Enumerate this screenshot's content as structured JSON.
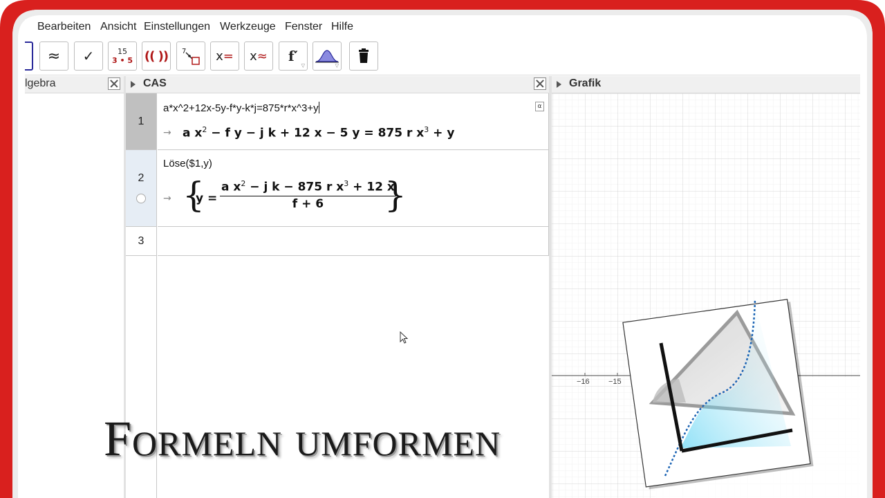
{
  "menu": [
    "Bearbeiten",
    "Ansicht",
    "Einstellungen",
    "Werkzeuge",
    "Fenster",
    "Hilfe"
  ],
  "toolbar": {
    "numeric_top": "15",
    "numeric_bottom": "3 • 5",
    "tools": [
      "approx-tool",
      "check-tool",
      "factor-tool",
      "expand-tool",
      "substitute-tool",
      "solve-tool",
      "nsolve-tool",
      "derivative-tool",
      "probability-tool",
      "delete-tool"
    ]
  },
  "panels": {
    "algebra_title": "lgebra",
    "cas_title": "CAS",
    "grafik_title": "Grafik"
  },
  "cas": {
    "rows": [
      {
        "number": "1",
        "input": "a*x^2+12x-5y-f*y-k*j=875*r*x^3+y",
        "badge": "α"
      },
      {
        "number": "2",
        "input": "Löse($1,y)"
      },
      {
        "number": "3",
        "input": ""
      }
    ],
    "arrow": "→"
  },
  "grafik": {
    "axis_labels": [
      "−16",
      "−15"
    ]
  },
  "overlay_title": "Formeln umformen",
  "colors": {
    "frame_red": "#d9201e",
    "cas_selected": "#c0c0c0",
    "cas_light": "#e6edf5",
    "accent_blue": "#2a2a9a",
    "curve_blue": "#1c64b4"
  }
}
